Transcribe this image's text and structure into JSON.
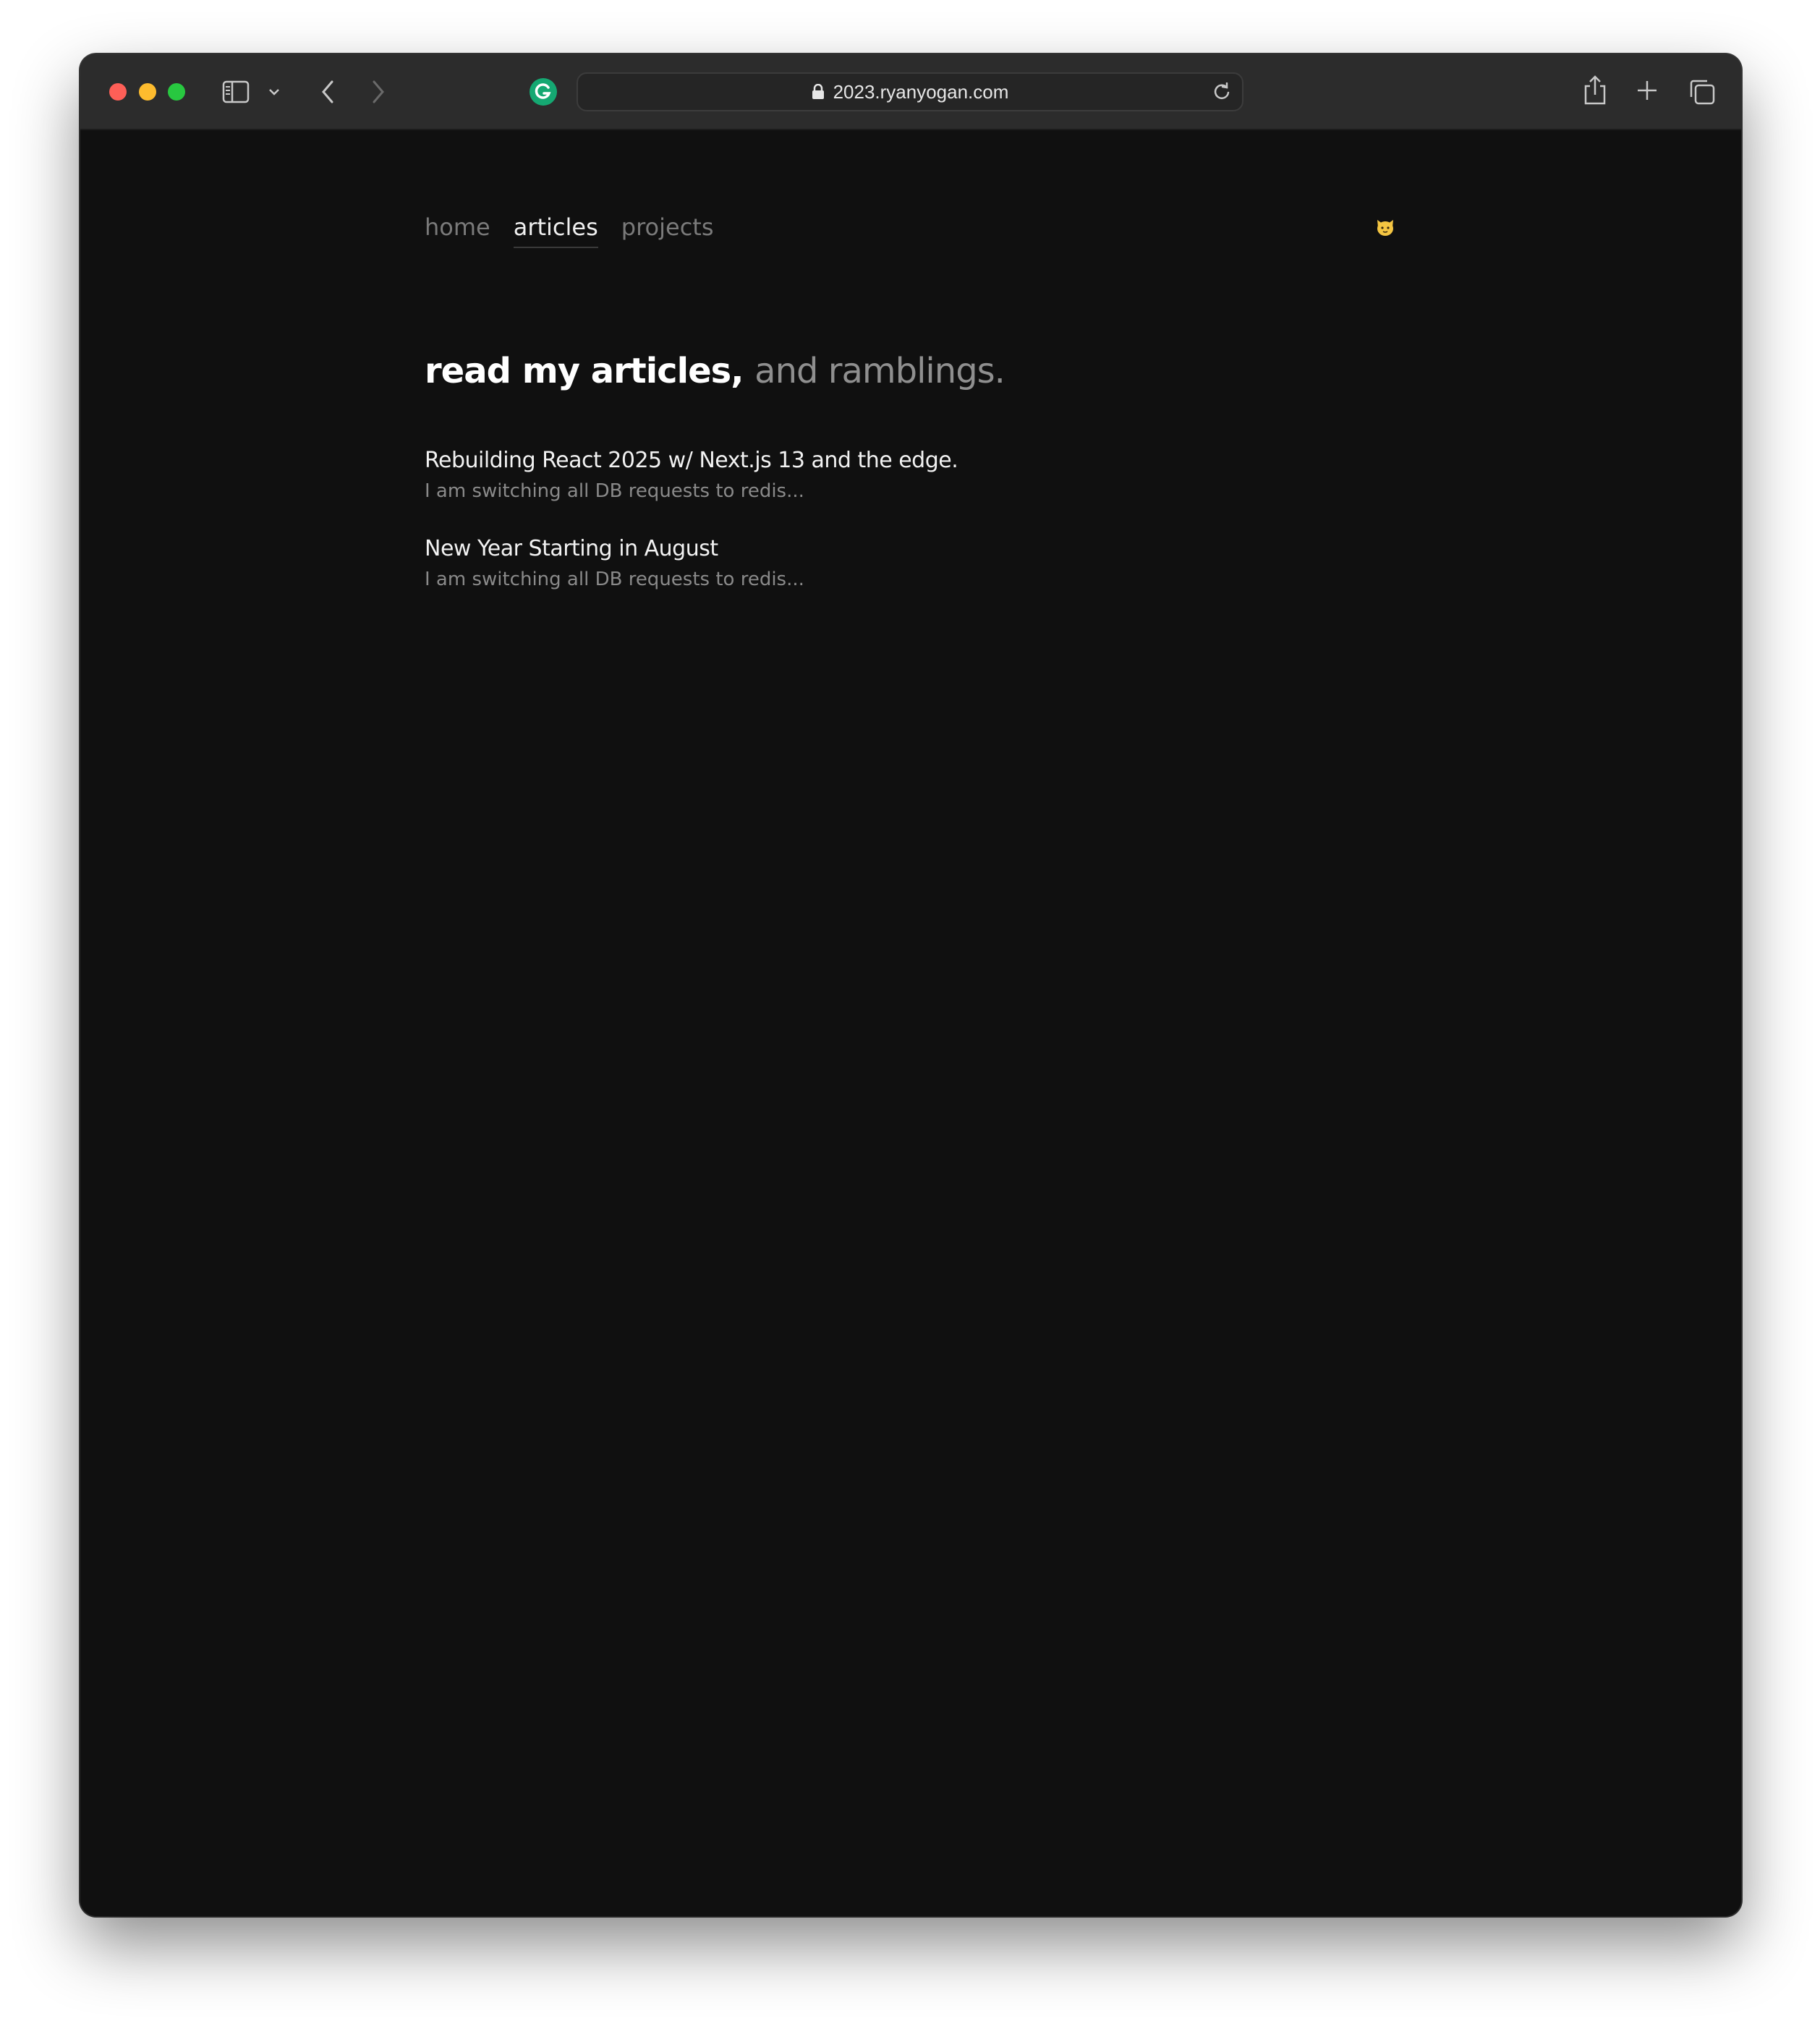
{
  "browser": {
    "url": "2023.ryanyogan.com",
    "icons": {
      "sidebar": "sidebar-icon",
      "chevron": "chevron-down-icon",
      "back": "back-arrow-icon",
      "forward": "forward-arrow-icon",
      "extension": "grammarly-icon",
      "lock": "lock-icon",
      "reload": "reload-icon",
      "share": "share-icon",
      "new_tab": "plus-icon",
      "tabs": "tab-overview-icon"
    },
    "colors": {
      "close": "#fe5f57",
      "minimize": "#febc2e",
      "maximize": "#28c840"
    }
  },
  "site": {
    "nav": [
      {
        "label": "home",
        "active": false
      },
      {
        "label": "articles",
        "active": true
      },
      {
        "label": "projects",
        "active": false
      }
    ],
    "theme_icon": "cat-emoji-icon",
    "headline": {
      "strong": "read my articles,",
      "light": "and ramblings."
    },
    "articles": [
      {
        "title": "Rebuilding React 2025 w/ Next.js 13 and the edge.",
        "description": "I am switching all DB requests to redis..."
      },
      {
        "title": "New Year Starting in August",
        "description": "I am switching all DB requests to redis..."
      }
    ],
    "colors": {
      "background": "#101010",
      "text_primary": "#f2f2f2",
      "text_muted": "#8a8a8a"
    }
  }
}
